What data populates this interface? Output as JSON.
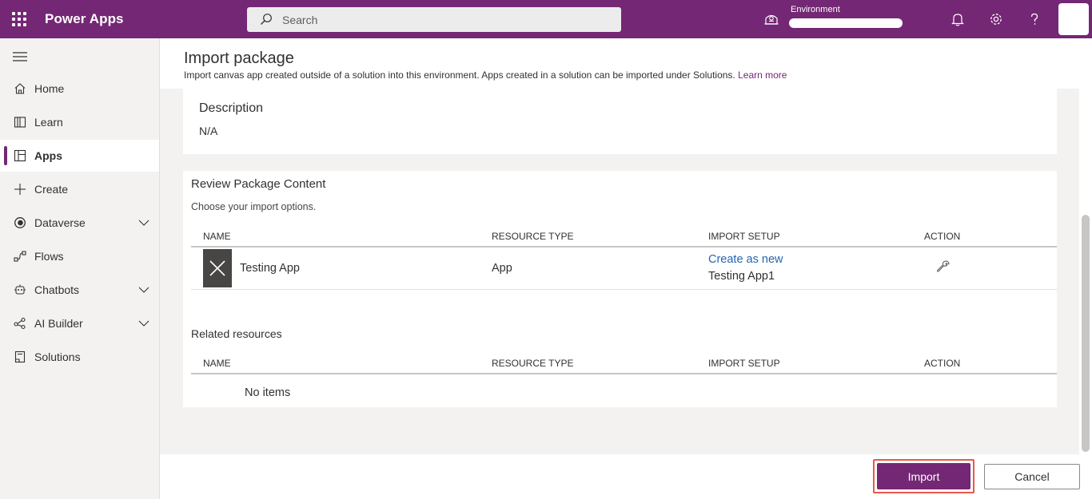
{
  "header": {
    "app_name": "Power Apps",
    "search_placeholder": "Search",
    "environment_label": "Environment",
    "icons": [
      "waffle-icon",
      "search-icon",
      "environment-icon",
      "notification-bell-icon",
      "settings-gear-icon",
      "help-question-icon"
    ]
  },
  "sidebar": {
    "items": [
      {
        "label": "Home",
        "icon": "home-icon"
      },
      {
        "label": "Learn",
        "icon": "book-icon"
      },
      {
        "label": "Apps",
        "icon": "apps-icon",
        "active": true
      },
      {
        "label": "Create",
        "icon": "plus-icon"
      },
      {
        "label": "Dataverse",
        "icon": "dataverse-icon",
        "expandable": true
      },
      {
        "label": "Flows",
        "icon": "flows-icon"
      },
      {
        "label": "Chatbots",
        "icon": "chatbot-icon",
        "expandable": true
      },
      {
        "label": "AI Builder",
        "icon": "ai-builder-icon",
        "expandable": true
      },
      {
        "label": "Solutions",
        "icon": "solutions-icon"
      }
    ]
  },
  "page": {
    "title": "Import package",
    "subtitle": "Import canvas app created outside of a solution into this environment. Apps created in a solution can be imported under Solutions.",
    "learn_more": "Learn more"
  },
  "description": {
    "label": "Description",
    "value": "N/A"
  },
  "review": {
    "title": "Review Package Content",
    "subtitle": "Choose your import options.",
    "columns": [
      "NAME",
      "RESOURCE TYPE",
      "IMPORT SETUP",
      "ACTION"
    ],
    "rows": [
      {
        "name": "Testing App",
        "resource_type": "App",
        "import_setup_link": "Create as new",
        "import_setup_name": "Testing App1",
        "action_icon": "wrench-icon"
      }
    ]
  },
  "related": {
    "title": "Related resources",
    "columns": [
      "NAME",
      "RESOURCE TYPE",
      "IMPORT SETUP",
      "ACTION"
    ],
    "empty_text": "No items"
  },
  "footer": {
    "import_label": "Import",
    "cancel_label": "Cancel"
  },
  "colors": {
    "brand": "#742774",
    "highlight_border": "#e9574a",
    "link": "#2266b0"
  }
}
